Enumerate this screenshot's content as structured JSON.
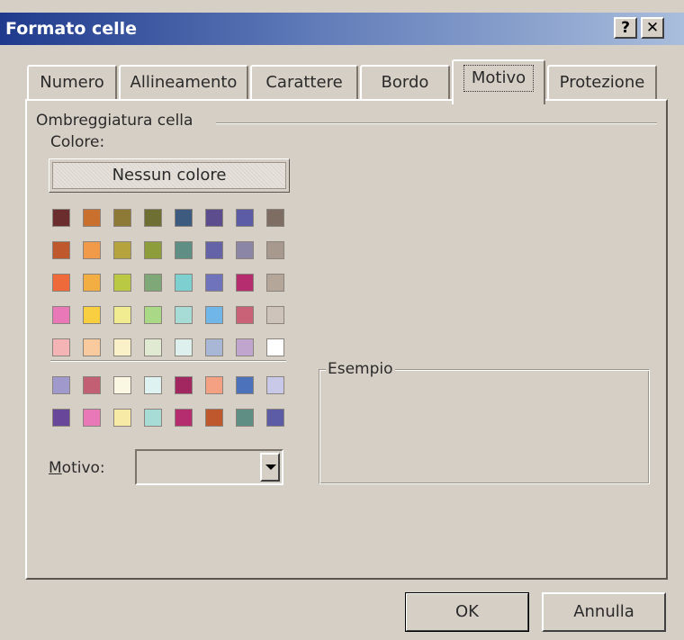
{
  "window": {
    "title": "Formato celle",
    "help_label": "?",
    "close_label": "✕"
  },
  "tabs": [
    {
      "label": "Numero"
    },
    {
      "label": "Allineamento"
    },
    {
      "label": "Carattere"
    },
    {
      "label": "Bordo"
    },
    {
      "label": "Motivo",
      "active": true
    },
    {
      "label": "Protezione"
    }
  ],
  "shading": {
    "group_label": "Ombreggiatura cella",
    "color_label": "Colore:",
    "no_color_label": "Nessun colore",
    "palette_rows": [
      [
        "#6b2d2d",
        "#c9702e",
        "#8c7a36",
        "#6e6f33",
        "#3d5a7f",
        "#5c4d8e",
        "#5b5ba6",
        "#7e6d63"
      ],
      [
        "#c0582e",
        "#f09a4a",
        "#b5a33e",
        "#8d9d3c",
        "#5e8e84",
        "#6563a8",
        "#8b86a6",
        "#a7998e"
      ],
      [
        "#ee6a3a",
        "#f2ae43",
        "#b9c944",
        "#7ea877",
        "#7ecfcf",
        "#6f73bc",
        "#b52d6e",
        "#b5a69a"
      ],
      [
        "#e878b8",
        "#f8cf40",
        "#f1ec91",
        "#a9d986",
        "#a6dcd5",
        "#70b6e8",
        "#c96276",
        "#cdc3bb"
      ],
      [
        "#f4b3b4",
        "#f8ca9e",
        "#fbf1c8",
        "#e0ead2",
        "#ddf0ee",
        "#a8b7d6",
        "#c0a5cf",
        "#ffffff"
      ]
    ],
    "chart_rows": [
      [
        "#9f9acb",
        "#c35f73",
        "#faf7e2",
        "#def2f1",
        "#a2265f",
        "#f4a183",
        "#4d72bc",
        "#c8c8e8"
      ],
      [
        "#68469a",
        "#e878b8",
        "#f6eaa6",
        "#a6dcd5",
        "#b52d6e",
        "#c0582e",
        "#5e8e84",
        "#5b5ba6"
      ]
    ],
    "pattern_label": "Motivo:",
    "pattern_value": ""
  },
  "sample": {
    "label": "Esempio"
  },
  "buttons": {
    "ok": "OK",
    "cancel": "Annulla"
  }
}
